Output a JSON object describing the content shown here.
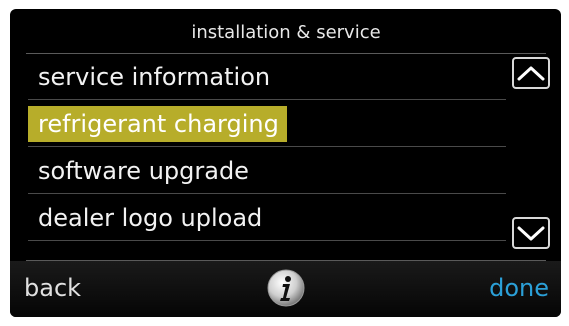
{
  "header": {
    "title": "installation & service"
  },
  "menu": {
    "items": [
      {
        "label": "service information",
        "selected": false
      },
      {
        "label": "refrigerant charging",
        "selected": true
      },
      {
        "label": "software upgrade",
        "selected": false
      },
      {
        "label": "dealer logo upload",
        "selected": false
      }
    ]
  },
  "scroll": {
    "up_icon": "chevron-up-icon",
    "down_icon": "chevron-down-icon"
  },
  "footer": {
    "back_label": "back",
    "info_icon": "info-icon",
    "done_label": "done"
  },
  "colors": {
    "highlight": "#b7ad2a",
    "done": "#2ba0d8",
    "screen_background": "#000000"
  }
}
